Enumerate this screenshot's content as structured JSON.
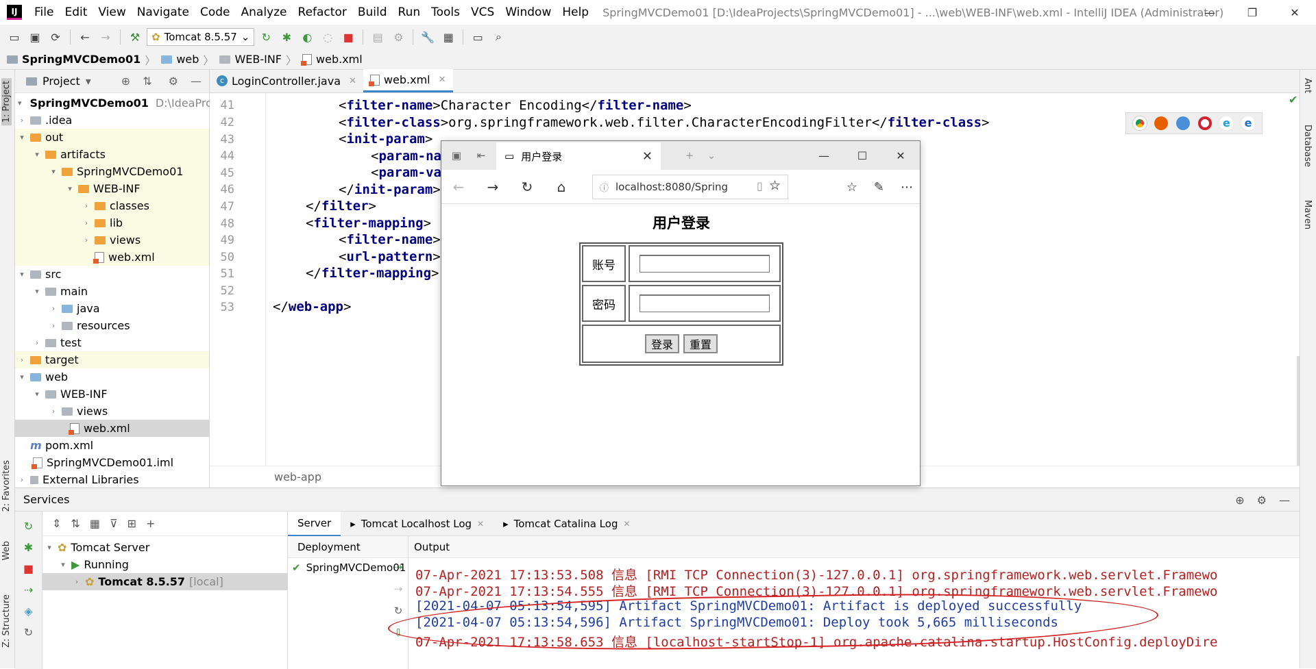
{
  "titlebar": {
    "logo": "IJ",
    "menu": [
      "File",
      "Edit",
      "View",
      "Navigate",
      "Code",
      "Analyze",
      "Refactor",
      "Build",
      "Run",
      "Tools",
      "VCS",
      "Window",
      "Help"
    ],
    "title": "SpringMVCDemo01 [D:\\IdeaProjects\\SpringMVCDemo01] - ...\\web\\WEB-INF\\web.xml - IntelliJ IDEA (Administrator)",
    "min": "—",
    "max": "❐",
    "close": "✕"
  },
  "toolbar": {
    "run_config": "Tomcat 8.5.57"
  },
  "breadcrumbs": [
    "SpringMVCDemo01",
    "web",
    "WEB-INF",
    "web.xml"
  ],
  "leftstrip": {
    "project": "1: Project",
    "favorites": "2: Favorites",
    "web": "Web",
    "structure": "Z: Structure"
  },
  "rightstrip": {
    "ant": "Ant",
    "database": "Database",
    "maven": "Maven"
  },
  "project": {
    "header": "Project",
    "root": "SpringMVCDemo01",
    "root_path": "D:\\IdeaProjec",
    "items": [
      ".idea",
      "out",
      "artifacts",
      "SpringMVCDemo01",
      "WEB-INF",
      "classes",
      "lib",
      "views",
      "web.xml",
      "src",
      "main",
      "java",
      "resources",
      "test",
      "target",
      "web",
      "WEB-INF",
      "views",
      "web.xml",
      "pom.xml",
      "SpringMVCDemo01.iml",
      "External Libraries"
    ]
  },
  "tabs": [
    "LoginController.java",
    "web.xml"
  ],
  "editor": {
    "line_numbers": [
      "41",
      "42",
      "43",
      "44",
      "45",
      "46",
      "47",
      "48",
      "49",
      "50",
      "51",
      "52",
      "53"
    ],
    "lines": [
      {
        "a": "<",
        "t": "filter-name",
        "b": ">Character Encoding</",
        "t2": "filter-name",
        "c": ">"
      },
      {
        "a": "<",
        "t": "filter-class",
        "b": ">org.springframework.web.filter.CharacterEncodingFilter</",
        "t2": "filter-class",
        "c": ">"
      },
      {
        "a": "<",
        "t": "init-param",
        "b": ">",
        "t2": "",
        "c": ""
      },
      {
        "a": "<",
        "t": "param-na",
        "b": "",
        "t2": "",
        "c": ""
      },
      {
        "a": "<",
        "t": "param-va",
        "b": "",
        "t2": "",
        "c": ""
      },
      {
        "a": "</",
        "t": "init-param",
        "b": ">",
        "t2": "",
        "c": ""
      },
      {
        "a": "</",
        "t": "filter",
        "b": ">",
        "t2": "",
        "c": ""
      },
      {
        "a": "<",
        "t": "filter-mapping",
        "b": ">",
        "t2": "",
        "c": ""
      },
      {
        "a": "<",
        "t": "filter-name",
        "b": ">",
        "t2": "",
        "c": ""
      },
      {
        "a": "<",
        "t": "url-pattern",
        "b": ">",
        "t2": "",
        "c": ""
      },
      {
        "a": "</",
        "t": "filter-mapping",
        "b": ">",
        "t2": "",
        "c": ""
      },
      {
        "a": "",
        "t": "",
        "b": "",
        "t2": "",
        "c": ""
      },
      {
        "a": "</",
        "t": "web-app",
        "b": ">",
        "t2": "",
        "c": ""
      }
    ],
    "footer": "web-app"
  },
  "browser": {
    "tab_title": "用户登录",
    "url": "localhost:8080/Spring",
    "page_title": "用户登录",
    "label_account": "账号",
    "label_password": "密码",
    "login_btn": "登录",
    "reset_btn": "重置"
  },
  "services": {
    "title": "Services",
    "tree": {
      "server": "Tomcat Server",
      "running": "Running",
      "instance": "Tomcat 8.5.57",
      "instance_tag": "[local]"
    },
    "tabs": [
      "Server",
      "Tomcat Localhost Log",
      "Tomcat Catalina Log"
    ],
    "deployment_header": "Deployment",
    "deployment_item": "SpringMVCDemo01",
    "output_header": "Output",
    "output": [
      {
        "text": "07-Apr-2021 17:13:53.508 信息 [RMI TCP Connection(3)-127.0.0.1] org.springframework.web.servlet.Framewo",
        "color": "red"
      },
      {
        "text": "07-Apr-2021 17:13:54.555 信息 [RMI TCP Connection(3)-127.0.0.1] org.springframework.web.servlet.Framewo",
        "color": "red"
      },
      {
        "text": "[2021-04-07 05:13:54,595] Artifact SpringMVCDemo01: Artifact is deployed successfully",
        "color": "blue"
      },
      {
        "text": "[2021-04-07 05:13:54,596] Artifact SpringMVCDemo01: Deploy took 5,665 milliseconds",
        "color": "blue"
      },
      {
        "text": "07-Apr-2021 17:13:58.653 信息 [localhost-startStop-1] org.apache.catalina.startup.HostConfig.deployDire",
        "color": "red"
      }
    ]
  }
}
